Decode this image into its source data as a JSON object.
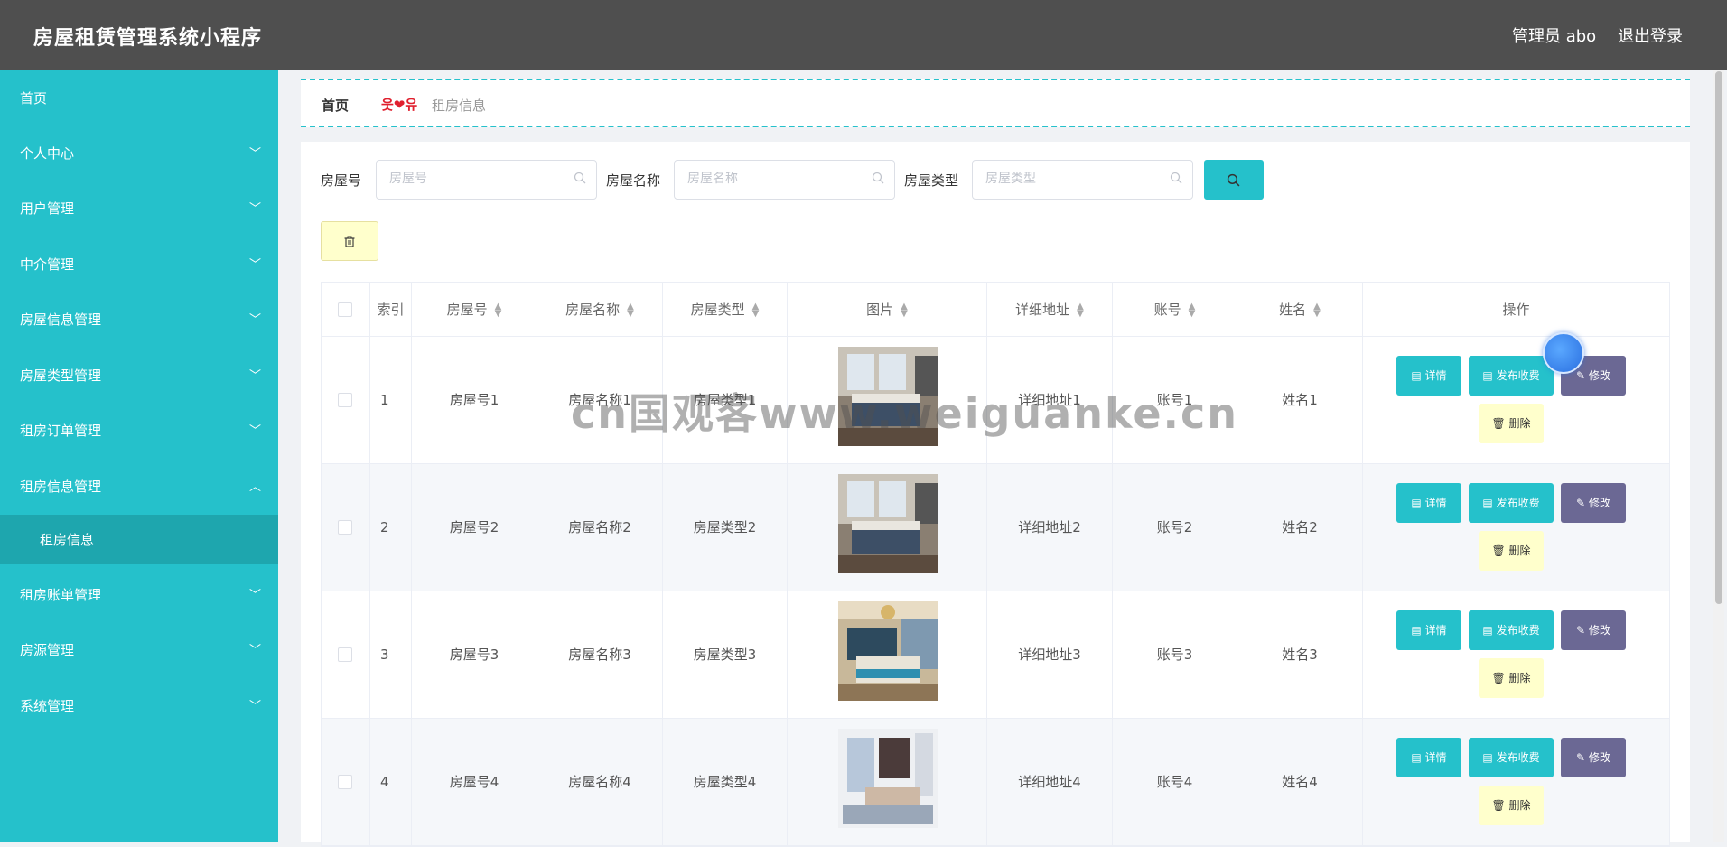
{
  "app": {
    "title": "房屋租赁管理系统小程序",
    "admin_label": "管理员 abo",
    "logout_label": "退出登录"
  },
  "sidebar": {
    "items": [
      {
        "label": "首页",
        "has_chevron": false
      },
      {
        "label": "个人中心",
        "has_chevron": true
      },
      {
        "label": "用户管理",
        "has_chevron": true
      },
      {
        "label": "中介管理",
        "has_chevron": true
      },
      {
        "label": "房屋信息管理",
        "has_chevron": true
      },
      {
        "label": "房屋类型管理",
        "has_chevron": true
      },
      {
        "label": "租房订单管理",
        "has_chevron": true
      },
      {
        "label": "租房信息管理",
        "has_chevron": true,
        "expanded": true
      },
      {
        "label": "租房账单管理",
        "has_chevron": true
      },
      {
        "label": "房源管理",
        "has_chevron": true
      },
      {
        "label": "系统管理",
        "has_chevron": true
      }
    ],
    "sub_item": {
      "label": "租房信息"
    }
  },
  "breadcrumb": {
    "home": "首页",
    "separator": "웃❤유",
    "current": "租房信息"
  },
  "search": {
    "fields": [
      {
        "label": "房屋号",
        "placeholder": "房屋号"
      },
      {
        "label": "房屋名称",
        "placeholder": "房屋名称"
      },
      {
        "label": "房屋类型",
        "placeholder": "房屋类型"
      }
    ]
  },
  "table": {
    "headers": [
      "索引",
      "房屋号",
      "房屋名称",
      "房屋类型",
      "图片",
      "详细地址",
      "账号",
      "姓名",
      "操作"
    ],
    "rows": [
      {
        "index": "1",
        "house_no": "房屋号1",
        "house_name": "房屋名称1",
        "house_type": "房屋类型1",
        "address": "详细地址1",
        "account": "账号1",
        "name": "姓名1"
      },
      {
        "index": "2",
        "house_no": "房屋号2",
        "house_name": "房屋名称2",
        "house_type": "房屋类型2",
        "address": "详细地址2",
        "account": "账号2",
        "name": "姓名2"
      },
      {
        "index": "3",
        "house_no": "房屋号3",
        "house_name": "房屋名称3",
        "house_type": "房屋类型3",
        "address": "详细地址3",
        "account": "账号3",
        "name": "姓名3"
      },
      {
        "index": "4",
        "house_no": "房屋号4",
        "house_name": "房屋名称4",
        "house_type": "房屋类型4",
        "address": "详细地址4",
        "account": "账号4",
        "name": "姓名4"
      }
    ],
    "actions": {
      "detail": "详情",
      "fee": "发布收费",
      "edit": "修改",
      "delete": "删除"
    }
  },
  "watermark": "cn国观客www.weiguanke.cn",
  "colors": {
    "accent": "#25c1cb",
    "topbar": "#4f4f4f",
    "edit": "#6b6894",
    "delete_bg": "#ffffcc",
    "breadcrumb_sep": "#e0202e"
  }
}
